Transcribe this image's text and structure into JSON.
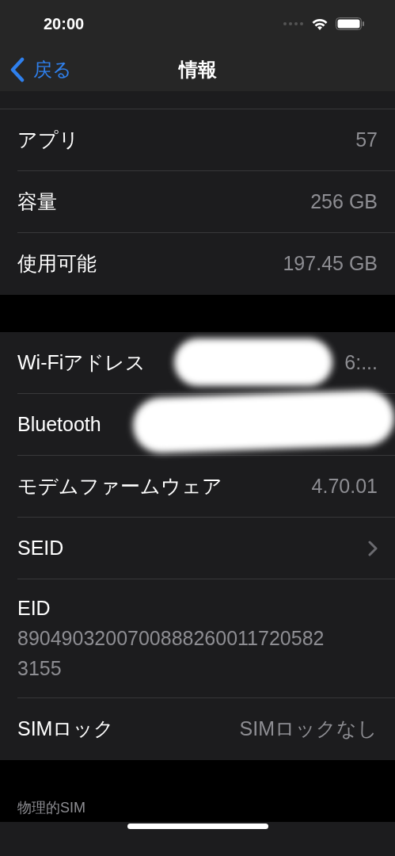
{
  "status_bar": {
    "time": "20:00"
  },
  "nav": {
    "back": "戻る",
    "title": "情報"
  },
  "groups": [
    {
      "rows": [
        {
          "kind": "value",
          "label": "アプリ",
          "value": "57"
        },
        {
          "kind": "value",
          "label": "容量",
          "value": "256 GB"
        },
        {
          "kind": "value",
          "label": "使用可能",
          "value": "197.45 GB"
        }
      ]
    },
    {
      "rows": [
        {
          "kind": "redacted",
          "label": "Wi-Fiアドレス",
          "value": "6:..."
        },
        {
          "kind": "redacted",
          "label": "Bluetooth"
        },
        {
          "kind": "value",
          "label": "モデムファームウェア",
          "value": "4.70.01"
        },
        {
          "kind": "link",
          "label": "SEID"
        },
        {
          "kind": "stacked",
          "label": "EID",
          "value": "89049032007008882600117205823155"
        },
        {
          "kind": "value",
          "label": "SIMロック",
          "value": "SIMロックなし"
        }
      ]
    }
  ],
  "section_header": "物理的SIM"
}
